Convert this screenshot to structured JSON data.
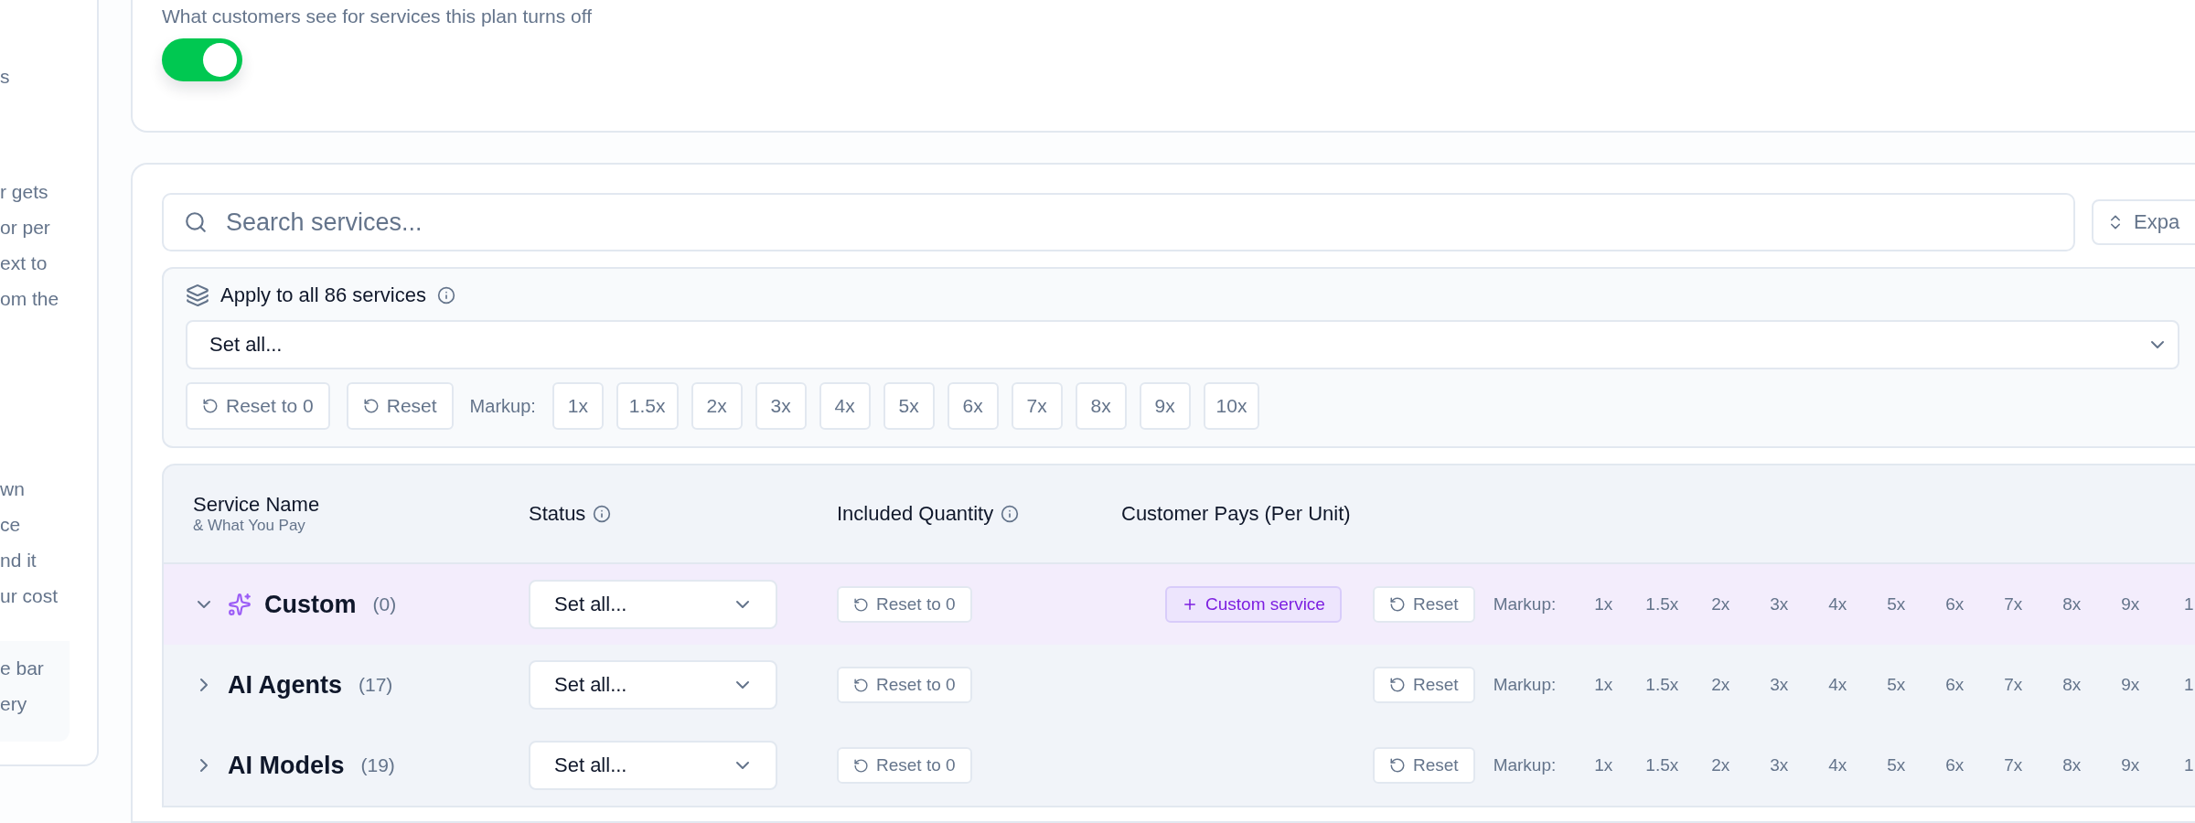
{
  "side_panel": {
    "paragraphs": [
      [
        "s"
      ],
      [
        "r gets",
        "or per",
        "ext to",
        "om the"
      ],
      [
        "wn",
        "ce",
        "nd it",
        "ur cost"
      ]
    ],
    "note_lines": [
      "e bar",
      "ery"
    ]
  },
  "display_setting": {
    "description": "What customers see for services this plan turns off",
    "on": true
  },
  "search": {
    "placeholder": "Search services..."
  },
  "expand_button": {
    "label": "Expa"
  },
  "apply_all": {
    "title": "Apply to all 86 services",
    "select_value": "Set all...",
    "reset_zero": "Reset to 0",
    "reset": "Reset",
    "markup_label": "Markup:",
    "markup_options": [
      "1x",
      "1.5x",
      "2x",
      "3x",
      "4x",
      "5x",
      "6x",
      "7x",
      "8x",
      "9x",
      "10x"
    ]
  },
  "table": {
    "columns": [
      {
        "title": "Service Name",
        "subtitle": "& What You Pay"
      },
      {
        "title": "Status",
        "info": true
      },
      {
        "title": "Included Quantity",
        "info": true
      },
      {
        "title": "Customer Pays (Per Unit)"
      }
    ],
    "rows": [
      {
        "kind": "custom",
        "name": "Custom",
        "count": "(0)",
        "expanded": true,
        "status": "Set all...",
        "reset_zero": "Reset to 0",
        "add_label": "Custom service",
        "reset": "Reset",
        "markup_label": "Markup:",
        "markup_options": [
          "1x",
          "1.5x",
          "2x",
          "3x",
          "4x",
          "5x",
          "6x",
          "7x",
          "8x",
          "9x",
          "1"
        ]
      },
      {
        "kind": "group",
        "name": "AI Agents",
        "count": "(17)",
        "expanded": false,
        "status": "Set all...",
        "reset_zero": "Reset to 0",
        "reset": "Reset",
        "markup_label": "Markup:",
        "markup_options": [
          "1x",
          "1.5x",
          "2x",
          "3x",
          "4x",
          "5x",
          "6x",
          "7x",
          "8x",
          "9x",
          "1"
        ]
      },
      {
        "kind": "group",
        "name": "AI Models",
        "count": "(19)",
        "expanded": false,
        "status": "Set all...",
        "reset_zero": "Reset to 0",
        "reset": "Reset",
        "markup_label": "Markup:",
        "markup_options": [
          "1x",
          "1.5x",
          "2x",
          "3x",
          "4x",
          "5x",
          "6x",
          "7x",
          "8x",
          "9x",
          "1"
        ]
      }
    ]
  }
}
